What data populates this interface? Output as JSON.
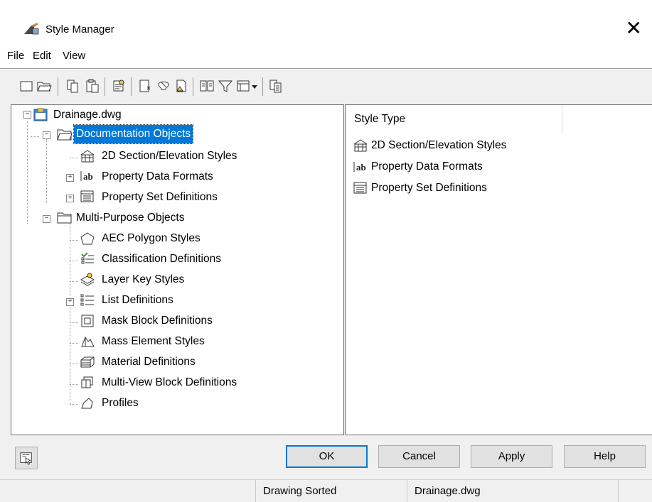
{
  "window": {
    "title": "Style Manager"
  },
  "menu": {
    "items": [
      "File",
      "Edit",
      "View"
    ]
  },
  "toolbar": {
    "icons": [
      "new-drawing-icon",
      "open-drawing-icon",
      "copy-icon",
      "paste-icon",
      "edit-style-icon",
      "new-style-icon",
      "purge-icon",
      "set-from-icon",
      "toggle-view-icon",
      "filter-icon",
      "view-options-icon",
      "sort-icon"
    ]
  },
  "tree": {
    "root": {
      "label": "Drainage.dwg"
    },
    "documentation": {
      "label": "Documentation Objects"
    },
    "doc_children": [
      {
        "label": "2D Section/Elevation Styles",
        "icon": "section-elevation-icon"
      },
      {
        "label": "Property Data Formats",
        "icon": "ab-format-icon"
      },
      {
        "label": "Property Set Definitions",
        "icon": "property-set-icon"
      }
    ],
    "multi": {
      "label": "Multi-Purpose Objects"
    },
    "multi_children": [
      {
        "label": "AEC Polygon Styles",
        "icon": "polygon-icon"
      },
      {
        "label": "Classification Definitions",
        "icon": "classification-icon"
      },
      {
        "label": "Layer Key Styles",
        "icon": "layer-key-icon"
      },
      {
        "label": "List Definitions",
        "icon": "list-icon"
      },
      {
        "label": "Mask Block Definitions",
        "icon": "mask-block-icon"
      },
      {
        "label": "Mass Element Styles",
        "icon": "mass-element-icon"
      },
      {
        "label": "Material Definitions",
        "icon": "material-icon"
      },
      {
        "label": "Multi-View Block Definitions",
        "icon": "multi-view-block-icon"
      },
      {
        "label": "Profiles",
        "icon": "profile-icon"
      }
    ]
  },
  "list": {
    "column_header": "Style Type",
    "rows": [
      {
        "label": "2D Section/Elevation Styles",
        "icon": "section-elevation-icon"
      },
      {
        "label": "Property Data Formats",
        "icon": "ab-format-icon"
      },
      {
        "label": "Property Set Definitions",
        "icon": "property-set-icon"
      }
    ]
  },
  "buttons": {
    "ok": "OK",
    "cancel": "Cancel",
    "apply": "Apply",
    "help": "Help"
  },
  "status": {
    "sort": "Drawing Sorted",
    "file": "Drainage.dwg"
  },
  "colors": {
    "selection": "#0078d7",
    "background": "#f0f0f0"
  }
}
